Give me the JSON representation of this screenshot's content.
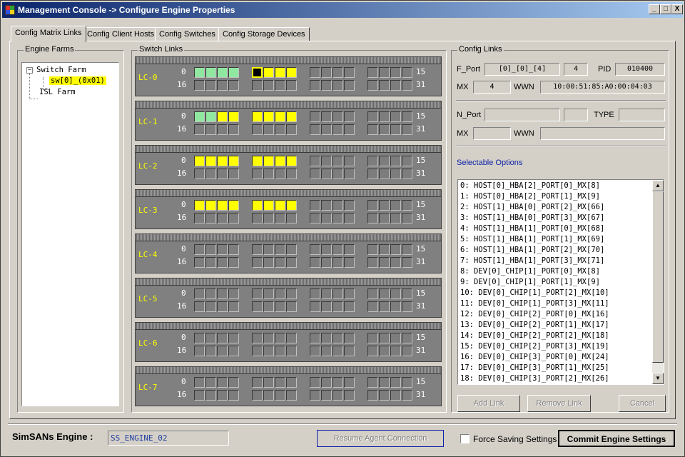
{
  "window": {
    "title": "Management Console -> Configure Engine Properties",
    "buttons": [
      "_",
      "□",
      "X"
    ]
  },
  "tabs": [
    {
      "label": "Config Matrix Links",
      "active": true
    },
    {
      "label": "Config Client Hosts",
      "active": false
    },
    {
      "label": "Config Switches",
      "active": false
    },
    {
      "label": "Config Storage Devices",
      "active": false
    }
  ],
  "engine_farms": {
    "title": "Engine Farms",
    "tree": {
      "switch_farm": "Switch Farm",
      "selected_switch": "sw[0]_(0x01)",
      "isl_farm": "ISL Farm",
      "expand_glyph": "−"
    }
  },
  "switch_links": {
    "title": "Switch Links",
    "port_start_top": "0",
    "port_end_top": "15",
    "port_start_bottom": "16",
    "port_end_bottom": "31",
    "rows": [
      {
        "label": "LC-0",
        "top": [
          "g",
          "g",
          "g",
          "g",
          "a",
          "y",
          "y",
          "y",
          "-",
          "-",
          "-",
          "-",
          "-",
          "-",
          "-",
          "-"
        ],
        "bottom": [
          "-",
          "-",
          "-",
          "-",
          "-",
          "-",
          "-",
          "-",
          "-",
          "-",
          "-",
          "-",
          "-",
          "-",
          "-",
          "-"
        ]
      },
      {
        "label": "LC-1",
        "top": [
          "g",
          "g",
          "y",
          "y",
          "y",
          "y",
          "y",
          "y",
          "-",
          "-",
          "-",
          "-",
          "-",
          "-",
          "-",
          "-"
        ],
        "bottom": [
          "-",
          "-",
          "-",
          "-",
          "-",
          "-",
          "-",
          "-",
          "-",
          "-",
          "-",
          "-",
          "-",
          "-",
          "-",
          "-"
        ]
      },
      {
        "label": "LC-2",
        "top": [
          "y",
          "y",
          "y",
          "y",
          "y",
          "y",
          "y",
          "y",
          "-",
          "-",
          "-",
          "-",
          "-",
          "-",
          "-",
          "-"
        ],
        "bottom": [
          "-",
          "-",
          "-",
          "-",
          "-",
          "-",
          "-",
          "-",
          "-",
          "-",
          "-",
          "-",
          "-",
          "-",
          "-",
          "-"
        ]
      },
      {
        "label": "LC-3",
        "top": [
          "y",
          "y",
          "y",
          "y",
          "y",
          "y",
          "y",
          "y",
          "-",
          "-",
          "-",
          "-",
          "-",
          "-",
          "-",
          "-"
        ],
        "bottom": [
          "-",
          "-",
          "-",
          "-",
          "-",
          "-",
          "-",
          "-",
          "-",
          "-",
          "-",
          "-",
          "-",
          "-",
          "-",
          "-"
        ]
      },
      {
        "label": "LC-4",
        "top": [
          "-",
          "-",
          "-",
          "-",
          "-",
          "-",
          "-",
          "-",
          "-",
          "-",
          "-",
          "-",
          "-",
          "-",
          "-",
          "-"
        ],
        "bottom": [
          "-",
          "-",
          "-",
          "-",
          "-",
          "-",
          "-",
          "-",
          "-",
          "-",
          "-",
          "-",
          "-",
          "-",
          "-",
          "-"
        ]
      },
      {
        "label": "LC-5",
        "top": [
          "-",
          "-",
          "-",
          "-",
          "-",
          "-",
          "-",
          "-",
          "-",
          "-",
          "-",
          "-",
          "-",
          "-",
          "-",
          "-"
        ],
        "bottom": [
          "-",
          "-",
          "-",
          "-",
          "-",
          "-",
          "-",
          "-",
          "-",
          "-",
          "-",
          "-",
          "-",
          "-",
          "-",
          "-"
        ]
      },
      {
        "label": "LC-6",
        "top": [
          "-",
          "-",
          "-",
          "-",
          "-",
          "-",
          "-",
          "-",
          "-",
          "-",
          "-",
          "-",
          "-",
          "-",
          "-",
          "-"
        ],
        "bottom": [
          "-",
          "-",
          "-",
          "-",
          "-",
          "-",
          "-",
          "-",
          "-",
          "-",
          "-",
          "-",
          "-",
          "-",
          "-",
          "-"
        ]
      },
      {
        "label": "LC-7",
        "top": [
          "-",
          "-",
          "-",
          "-",
          "-",
          "-",
          "-",
          "-",
          "-",
          "-",
          "-",
          "-",
          "-",
          "-",
          "-",
          "-"
        ],
        "bottom": [
          "-",
          "-",
          "-",
          "-",
          "-",
          "-",
          "-",
          "-",
          "-",
          "-",
          "-",
          "-",
          "-",
          "-",
          "-",
          "-"
        ]
      }
    ]
  },
  "config_links": {
    "title": "Config Links",
    "fport_label": "F_Port",
    "fport_value": "[0]_[0]_[4]",
    "fport_num": "4",
    "pid_label": "PID",
    "pid_value": "010400",
    "mx_label": "MX",
    "mx_value": "4",
    "wwn_label": "WWN",
    "wwn_value": "10:00:51:85:A0:00:04:03",
    "nport_label": "N_Port",
    "nport_value": "",
    "nport_num": "",
    "type_label": "TYPE",
    "type_value": "",
    "mx2_label": "MX",
    "mx2_value": "",
    "wwn2_label": "WWN",
    "wwn2_value": "",
    "selectable_title": "Selectable Options",
    "options": [
      "0: HOST[0]_HBA[2]_PORT[0]_MX[8]",
      "1: HOST[0]_HBA[2]_PORT[1]_MX[9]",
      "2: HOST[1]_HBA[0]_PORT[2]_MX[66]",
      "3: HOST[1]_HBA[0]_PORT[3]_MX[67]",
      "4: HOST[1]_HBA[1]_PORT[0]_MX[68]",
      "5: HOST[1]_HBA[1]_PORT[1]_MX[69]",
      "6: HOST[1]_HBA[1]_PORT[2]_MX[70]",
      "7: HOST[1]_HBA[1]_PORT[3]_MX[71]",
      "8: DEV[0]_CHIP[1]_PORT[0]_MX[8]",
      "9: DEV[0]_CHIP[1]_PORT[1]_MX[9]",
      "10: DEV[0]_CHIP[1]_PORT[2]_MX[10]",
      "11: DEV[0]_CHIP[1]_PORT[3]_MX[11]",
      "12: DEV[0]_CHIP[2]_PORT[0]_MX[16]",
      "13: DEV[0]_CHIP[2]_PORT[1]_MX[17]",
      "14: DEV[0]_CHIP[2]_PORT[2]_MX[18]",
      "15: DEV[0]_CHIP[2]_PORT[3]_MX[19]",
      "16: DEV[0]_CHIP[3]_PORT[0]_MX[24]",
      "17: DEV[0]_CHIP[3]_PORT[1]_MX[25]",
      "18: DEV[0]_CHIP[3]_PORT[2]_MX[26]"
    ],
    "add_link": "Add Link",
    "remove_link": "Remove Link",
    "cancel": "Cancel"
  },
  "footer": {
    "engine_label": "SimSANs Engine :",
    "engine_value": "SS_ENGINE_02",
    "resume_button": "Resume Agent Connection",
    "force_saving_label": "Force Saving Settings",
    "commit_button": "Commit Engine Settings"
  },
  "colors": {
    "port_green": "#90e8a0",
    "port_yellow": "#ffff00",
    "port_empty": "#7d7d7d",
    "label_yellow": "#ffff00",
    "link_blue": "#0b1fa8"
  }
}
